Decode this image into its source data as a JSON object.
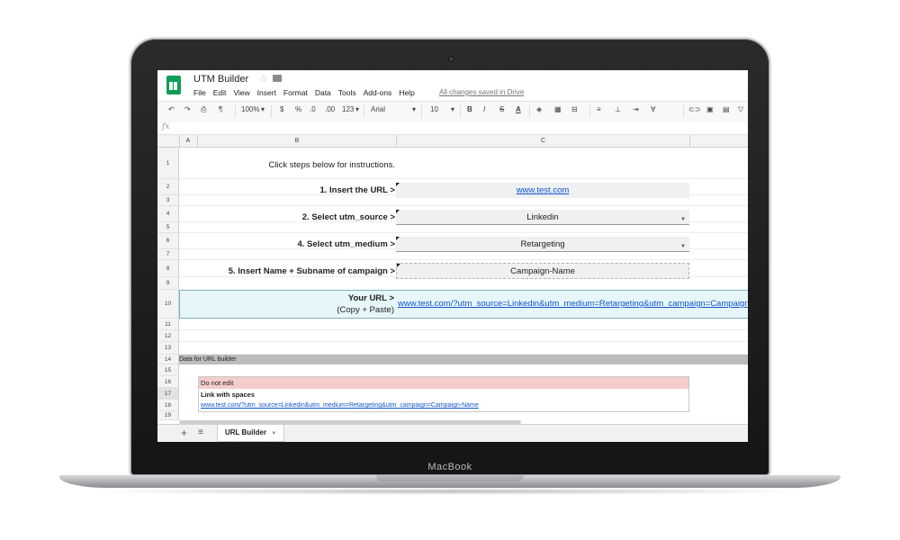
{
  "device": {
    "brand": "MacBook"
  },
  "doc": {
    "title": "UTM Builder",
    "menu": [
      "File",
      "Edit",
      "View",
      "Insert",
      "Format",
      "Data",
      "Tools",
      "Add-ons",
      "Help"
    ],
    "saved_status": "All changes saved in Drive"
  },
  "toolbar": {
    "zoom": "100%",
    "currency": "$",
    "percent": "%",
    "dec_decrease": ".0",
    "dec_increase": ".00",
    "more_formats": "123",
    "font": "Arial",
    "font_size": "10",
    "bold": "B",
    "italic": "I",
    "strike": "S",
    "text_color": "A"
  },
  "formula": {
    "fx": "fx"
  },
  "columns": [
    "A",
    "B",
    "C"
  ],
  "rows": [
    "1",
    "2",
    "3",
    "4",
    "5",
    "6",
    "7",
    "8",
    "9",
    "10",
    "11",
    "12",
    "13",
    "14",
    "15",
    "16",
    "17",
    "18",
    "19"
  ],
  "sheet": {
    "instructions": "Click steps below for instructions.",
    "step1_label": "1. Insert the URL >",
    "step1_value": "www.test.com",
    "step2_label": "2. Select utm_source >",
    "step2_value": "Linkedin",
    "step4_label": "4. Select utm_medium >",
    "step4_value": "Retargeting",
    "step5_label": "5. Insert Name + Subname of campaign >",
    "step5_value": "Campaign-Name",
    "your_url_label": "Your URL >",
    "your_url_hint": "(Copy + Paste)",
    "your_url_value": "www.test.com/?utm_source=Linkedin&utm_medium=Retargeting&utm_campaign=Campaign-Name",
    "data_header": "Data for URL builder",
    "do_not_edit": "Do not edit",
    "link_with_spaces": "Link with spaces",
    "link_value": "www.test.com/?utm_source=Linkedin&utm_medium=Retargeting&utm_campaign=Campaign-Name"
  },
  "tabs": {
    "add": "+",
    "list": "≡",
    "active": "URL Builder"
  },
  "colors": {
    "accent": "#0f9d58",
    "link": "#1155cc",
    "url_row": "#e6f6f9",
    "warn": "#f4cccc"
  }
}
